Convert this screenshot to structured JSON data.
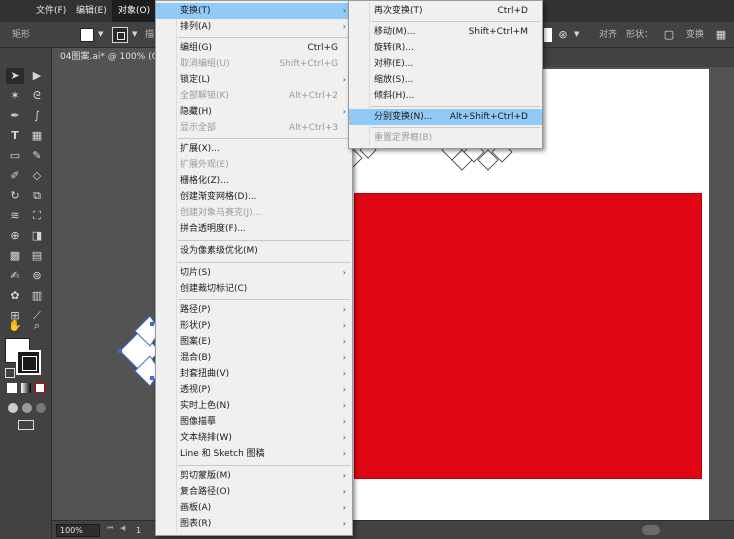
{
  "menubar": {
    "items": [
      {
        "label": "文件(F)"
      },
      {
        "label": "编辑(E)"
      },
      {
        "label": "对象(O)"
      }
    ]
  },
  "controlbar": {
    "shape_label": "矩形",
    "label_truncated_1": "描",
    "align_label": "对齐",
    "shape_props_label": "形状：",
    "transform_label": "变换"
  },
  "document": {
    "tab_title": "04图案.ai* @ 100% (C"
  },
  "statusbar": {
    "zoom": "100%",
    "page": "1"
  },
  "colors": {
    "red_rect": "#e10613",
    "menu_highlight": "#91c9f7"
  },
  "object_menu": {
    "items": [
      {
        "label": "变换(T)",
        "shortcut": "",
        "submenu": true,
        "disabled": false,
        "highlighted": true
      },
      {
        "label": "排列(A)",
        "shortcut": "",
        "submenu": true,
        "disabled": false
      },
      {
        "label": "编组(G)",
        "shortcut": "Ctrl+G",
        "submenu": false,
        "disabled": false
      },
      {
        "label": "取消编组(U)",
        "shortcut": "Shift+Ctrl+G",
        "submenu": false,
        "disabled": true
      },
      {
        "label": "锁定(L)",
        "shortcut": "",
        "submenu": true,
        "disabled": false
      },
      {
        "label": "全部解锁(K)",
        "shortcut": "Alt+Ctrl+2",
        "submenu": false,
        "disabled": true
      },
      {
        "label": "隐藏(H)",
        "shortcut": "",
        "submenu": true,
        "disabled": false
      },
      {
        "label": "显示全部",
        "shortcut": "Alt+Ctrl+3",
        "submenu": false,
        "disabled": true
      },
      {
        "label": "扩展(X)...",
        "shortcut": "",
        "submenu": false,
        "disabled": false
      },
      {
        "label": "扩展外观(E)",
        "shortcut": "",
        "submenu": false,
        "disabled": true
      },
      {
        "label": "栅格化(Z)...",
        "shortcut": "",
        "submenu": false,
        "disabled": false
      },
      {
        "label": "创建渐变网格(D)...",
        "shortcut": "",
        "submenu": false,
        "disabled": false
      },
      {
        "label": "创建对象马赛克(J)...",
        "shortcut": "",
        "submenu": false,
        "disabled": true
      },
      {
        "label": "拼合透明度(F)...",
        "shortcut": "",
        "submenu": false,
        "disabled": false
      },
      {
        "label": "设为像素级优化(M)",
        "shortcut": "",
        "submenu": false,
        "disabled": false
      },
      {
        "label": "切片(S)",
        "shortcut": "",
        "submenu": true,
        "disabled": false
      },
      {
        "label": "创建裁切标记(C)",
        "shortcut": "",
        "submenu": false,
        "disabled": false
      },
      {
        "label": "路径(P)",
        "shortcut": "",
        "submenu": true,
        "disabled": false
      },
      {
        "label": "形状(P)",
        "shortcut": "",
        "submenu": true,
        "disabled": false
      },
      {
        "label": "图案(E)",
        "shortcut": "",
        "submenu": true,
        "disabled": false
      },
      {
        "label": "混合(B)",
        "shortcut": "",
        "submenu": true,
        "disabled": false
      },
      {
        "label": "封套扭曲(V)",
        "shortcut": "",
        "submenu": true,
        "disabled": false
      },
      {
        "label": "透视(P)",
        "shortcut": "",
        "submenu": true,
        "disabled": false
      },
      {
        "label": "实时上色(N)",
        "shortcut": "",
        "submenu": true,
        "disabled": false
      },
      {
        "label": "图像描摹",
        "shortcut": "",
        "submenu": true,
        "disabled": false
      },
      {
        "label": "文本绕排(W)",
        "shortcut": "",
        "submenu": true,
        "disabled": false
      },
      {
        "label": "Line 和 Sketch 图稿",
        "shortcut": "",
        "submenu": true,
        "disabled": false
      },
      {
        "label": "剪切蒙版(M)",
        "shortcut": "",
        "submenu": true,
        "disabled": false
      },
      {
        "label": "复合路径(O)",
        "shortcut": "",
        "submenu": true,
        "disabled": false
      },
      {
        "label": "画板(A)",
        "shortcut": "",
        "submenu": true,
        "disabled": false
      },
      {
        "label": "图表(R)",
        "shortcut": "",
        "submenu": true,
        "disabled": false
      }
    ]
  },
  "transform_menu": {
    "items": [
      {
        "label": "再次变换(T)",
        "shortcut": "Ctrl+D",
        "disabled": false
      },
      {
        "label": "移动(M)...",
        "shortcut": "Shift+Ctrl+M",
        "disabled": false
      },
      {
        "label": "旋转(R)...",
        "shortcut": "",
        "disabled": false
      },
      {
        "label": "对称(E)...",
        "shortcut": "",
        "disabled": false
      },
      {
        "label": "缩放(S)...",
        "shortcut": "",
        "disabled": false
      },
      {
        "label": "倾斜(H)...",
        "shortcut": "",
        "disabled": false
      },
      {
        "label": "分别变换(N)...",
        "shortcut": "Alt+Shift+Ctrl+D",
        "disabled": false,
        "highlighted": true
      },
      {
        "label": "重置定界框(B)",
        "shortcut": "",
        "disabled": true
      }
    ]
  }
}
